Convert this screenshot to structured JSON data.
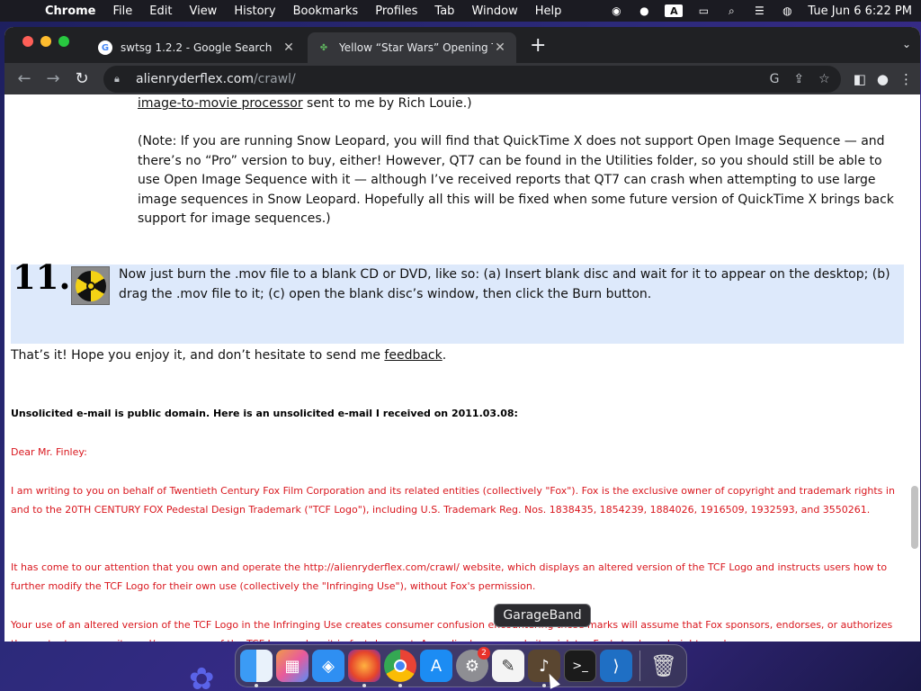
{
  "menubar": {
    "app": "Chrome",
    "items": [
      "File",
      "Edit",
      "View",
      "History",
      "Bookmarks",
      "Profiles",
      "Tab",
      "Window",
      "Help"
    ],
    "clock": "Tue Jun 6  6:22 PM",
    "input_indicator": "A"
  },
  "tabs": [
    {
      "title": "swtsg 1.2.2 - Google Search",
      "icon": "google-icon"
    },
    {
      "title": "Yellow “Star Wars” Opening Te",
      "icon": "clover-icon"
    }
  ],
  "address": {
    "host": "alienryderflex.com",
    "path": "/crawl/"
  },
  "page": {
    "top_link": "image-to-movie processor",
    "top_rest": " sent to me by Rich Louie.)",
    "note": "(Note: If you are running Snow Leopard, you will find that QuickTime X does not support Open Image Sequence — and there’s no “Pro” version to buy, either! However, QT7 can be found in the Utilities folder, so you should still be able to use Open Image Sequence with it — although I’ve received reports that QT7 can crash when attempting to use large image sequences in Snow Leopard. Hopefully all this will be fixed when some future version of QuickTime X brings back support for image sequences.)",
    "step_number": "11.",
    "step_text": "Now just burn the .mov file to a blank CD or DVD, like so: (a) Insert blank disc and wait for it to appear on the desktop; (b) drag the .mov file to it; (c) open the blank disc’s window, then click the Burn button.",
    "thatsit_before": "That’s it! Hope you enjoy it, and don’t hesitate to send me ",
    "feedback_link": "feedback",
    "thatsit_after": ".",
    "email_heading": "Unsolicited e-mail is public domain. Here is an unsolicited e-mail I received on 2011.03.08:",
    "dear": "Dear Mr. Finley:",
    "para1": "I am writing to you on behalf of Twentieth Century Fox Film Corporation and its related entities (collectively \"Fox\"). Fox is the exclusive owner of copyright and trademark rights in and to the 20TH CENTURY FOX Pedestal Design Trademark (\"TCF Logo\"), including U.S. Trademark Reg. Nos. 1838435, 1854239, 1884026, 1916509, 1932593, and 3550261.",
    "para2": "It has come to our attention that you own and operate the http://alienryderflex.com/crawl/ website, which displays an altered version of the TCF Logo and instructs users how to further modify the TCF Logo for their own use (collectively the \"Infringing Use\"), without Fox's permission.",
    "para3": "Your use of an altered version of the TCF Logo in the Infringing Use creates consumer confusion                encountering those marks will assume that Fox sponsors, endorses, or authorizes the content on your site and/or your use of the TCF Logo, when it in fact does not. Accordingly, your website violates Fox's trademark rights and"
  },
  "dock": {
    "tooltip": "GarageBand",
    "apps": [
      "finder-icon",
      "launchpad-icon",
      "safari-icon",
      "firefox-icon",
      "chrome-icon",
      "app-store-icon",
      "system-settings-icon",
      "textedit-icon",
      "garageband-icon",
      "terminal-icon",
      "vscode-icon",
      "trash-icon"
    ],
    "settings_badge": "2"
  },
  "colors": {
    "highlight": "#dde9fb",
    "legal_red": "#d9171e"
  }
}
